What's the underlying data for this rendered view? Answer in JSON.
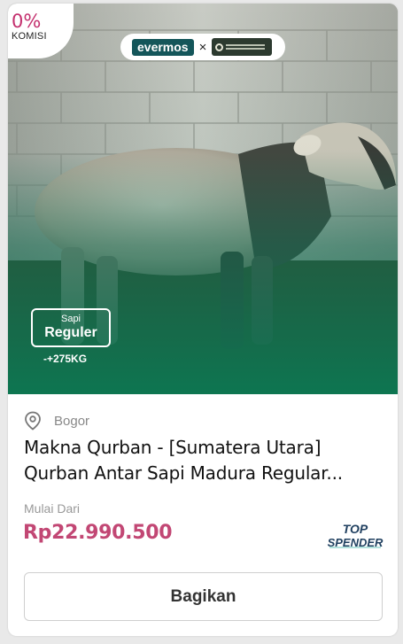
{
  "badge": {
    "percent": "0%",
    "label": "KOMISI"
  },
  "brand": {
    "primary": "evermos",
    "separator": "×",
    "partner_icon": "maknaqurban-logo"
  },
  "product_image": {
    "subject": "cow-photo",
    "tag_line1": "Sapi",
    "tag_line2": "Reguler",
    "weight": "-+275KG"
  },
  "location": {
    "icon": "location-pin-icon",
    "city": "Bogor"
  },
  "product": {
    "title_line1": "Makna Qurban - [Sumatera Utara]",
    "title_line2": "Qurban Antar Sapi Madura Regular..."
  },
  "pricing": {
    "label": "Mulai Dari",
    "price": "Rp22.990.500"
  },
  "seller_badge": {
    "line1": "TOP",
    "line2": "SPENDER"
  },
  "actions": {
    "share_label": "Bagikan"
  },
  "colors": {
    "accent": "#c4306e",
    "price": "#c24774",
    "brand": "#14565a",
    "overlay": "#0e6b4e"
  }
}
